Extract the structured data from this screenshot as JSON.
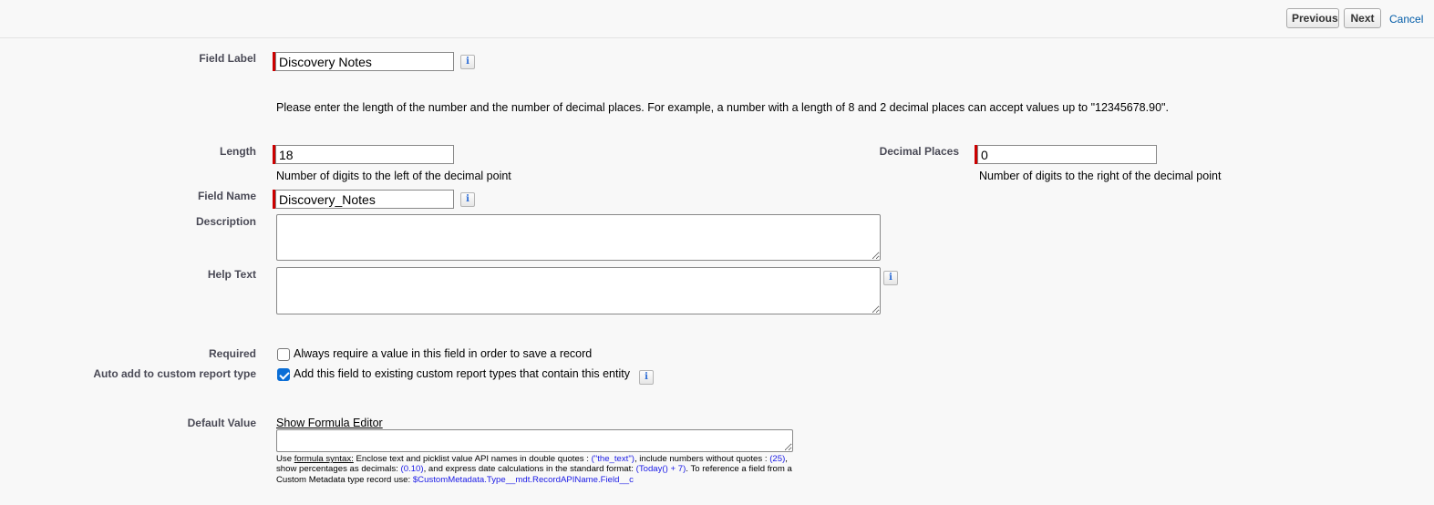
{
  "topbar": {
    "previous_label": "Previous",
    "next_label": "Next",
    "cancel_label": "Cancel"
  },
  "field_label": {
    "label": "Field Label",
    "value": "Discovery Notes"
  },
  "instructions": "Please enter the length of the number and the number of decimal places. For example, a number with a length of 8 and 2 decimal places can accept values up to \"12345678.90\".",
  "length": {
    "label": "Length",
    "value": "18",
    "hint": "Number of digits to the left of the decimal point"
  },
  "decimal_places": {
    "label": "Decimal Places",
    "value": "0",
    "hint": "Number of digits to the right of the decimal point"
  },
  "field_name": {
    "label": "Field Name",
    "value": "Discovery_Notes"
  },
  "description": {
    "label": "Description",
    "value": ""
  },
  "help_text": {
    "label": "Help Text",
    "value": ""
  },
  "required": {
    "label": "Required",
    "checkbox_text": "Always require a value in this field in order to save a record",
    "checked": false
  },
  "auto_add": {
    "label": "Auto add to custom report type",
    "checkbox_text": "Add this field to existing custom report types that contain this entity",
    "checked": true
  },
  "default_value": {
    "label": "Default Value",
    "formula_editor_link": "Show Formula Editor",
    "value": "",
    "help": {
      "p1": "Use ",
      "syntax_link": "formula syntax:",
      "p2": " Enclose text and picklist value API names in double quotes : ",
      "ex1": "(\"the_text\")",
      "p3": ", include numbers without quotes : ",
      "ex2": "(25)",
      "p4": ", show percentages as decimals: ",
      "ex3": "(0.10)",
      "p5": ", and express date calculations in the standard format: ",
      "ex4": "(Today() + 7)",
      "p6": ". To reference a field from a Custom Metadata type record use: ",
      "ex5": "$CustomMetadata.Type__mdt.RecordAPIName.Field__c"
    }
  },
  "icons": {
    "info": "info-icon",
    "info_glyph": "i"
  },
  "colors": {
    "required_bar": "#cc0000",
    "link": "#015ba7",
    "checkbox_checked": "#0b6ed6",
    "formula_example": "#1a1ae6"
  }
}
